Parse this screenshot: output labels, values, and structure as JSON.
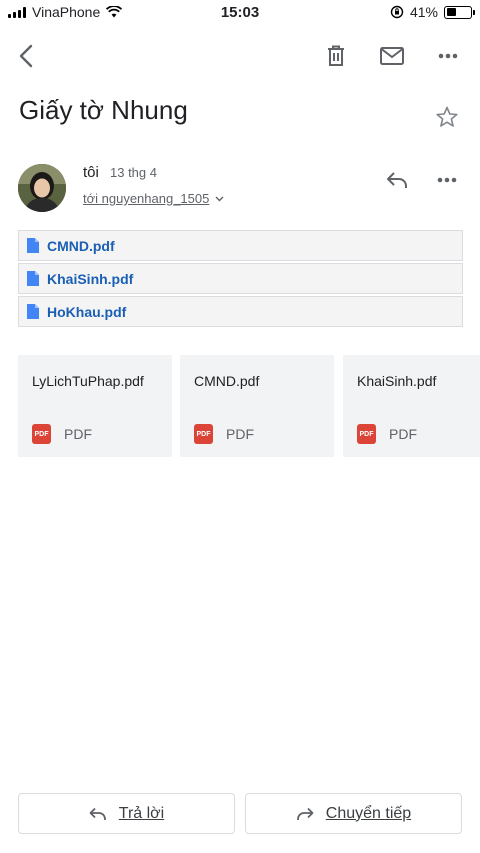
{
  "status_bar": {
    "carrier": "VinaPhone",
    "time": "15:03",
    "battery_percent": "41%",
    "battery_level": 0.41
  },
  "toolbar": {
    "back_icon": "back-arrow-icon",
    "delete_icon": "trash-icon",
    "mail_icon": "mail-icon",
    "more_icon": "more-horizontal-icon"
  },
  "email": {
    "subject": "Giấy tờ Nhung",
    "sender": "tôi",
    "date": "13 thg 4",
    "to_line": "tới nguyenhang_1505"
  },
  "inline_attachments": [
    {
      "name": "CMND.pdf"
    },
    {
      "name": "KhaiSinh.pdf"
    },
    {
      "name": "HoKhau.pdf"
    }
  ],
  "attachment_cards": [
    {
      "name": "LyLichTuPhap.pdf",
      "type": "PDF",
      "badge": "PDF"
    },
    {
      "name": "CMND.pdf",
      "type": "PDF",
      "badge": "PDF"
    },
    {
      "name": "KhaiSinh.pdf",
      "type": "PDF",
      "badge": "PDF"
    }
  ],
  "actions": {
    "reply_label": "Trả lời",
    "forward_label": "Chuyển tiếp"
  },
  "colors": {
    "link_blue": "#1a5fb4",
    "pdf_red": "#db4437",
    "file_icon_blue": "#4285f4"
  }
}
